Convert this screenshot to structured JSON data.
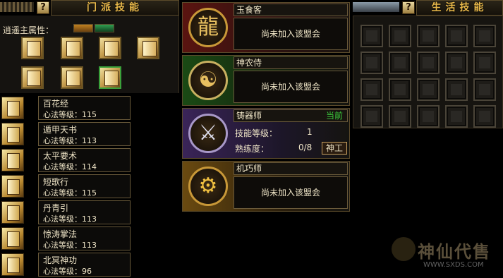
{
  "left_panel": {
    "help_label": "?",
    "title": "门派技能",
    "attribute_label": "逍遥主属性：",
    "skills": [
      {
        "name": "百花经",
        "level": "心法等级：115"
      },
      {
        "name": "遁甲天书",
        "level": "心法等级：113"
      },
      {
        "name": "太平要术",
        "level": "心法等级：114"
      },
      {
        "name": "短歌行",
        "level": "心法等级：115"
      },
      {
        "name": "丹青引",
        "level": "心法等级：113"
      },
      {
        "name": "惊涛掌法",
        "level": "心法等级：113"
      },
      {
        "name": "北冥神功",
        "level": "心法等级：96"
      }
    ]
  },
  "guilds": [
    {
      "name": "玉食客",
      "status": "尚未加入该盟会",
      "emblem": "dragon-emblem-icon",
      "color": "#5a1410"
    },
    {
      "name": "神农侍",
      "status": "尚未加入该盟会",
      "emblem": "yin-yang-leaf-emblem-icon",
      "color": "#1a4a14"
    },
    {
      "name": "铸器师",
      "current": "当前",
      "skill_level_label": "技能等级：",
      "skill_level": "1",
      "proficiency_label": "熟练度：",
      "proficiency": "0/8",
      "button": "神工",
      "emblem": "weapon-rack-emblem-icon",
      "color": "#3a2458"
    },
    {
      "name": "机巧师",
      "status": "尚未加入该盟会",
      "emblem": "gear-emblem-icon",
      "color": "#6a4a10"
    }
  ],
  "right_panel": {
    "help_label": "?",
    "title": "生活技能",
    "slots_rows": 4,
    "slots_cols": 5
  },
  "watermark": {
    "text": "神仙代售",
    "url": "WWW.SXDS.COM"
  }
}
